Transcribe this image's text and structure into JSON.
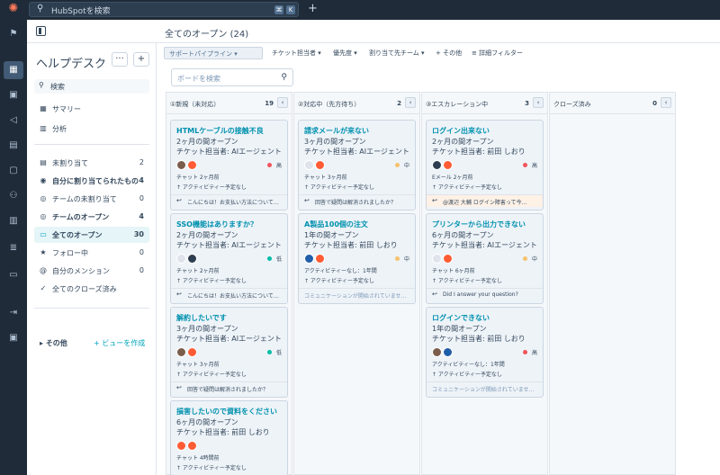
{
  "topbar": {
    "search_placeholder": "HubSpotを検索",
    "kbd1": "⌘",
    "kbd2": "K",
    "plus": "+"
  },
  "header": {
    "title": "全てのオープン (24)"
  },
  "sidebar": {
    "title": "ヘルプデスク",
    "more_btn": "···",
    "add_btn": "+",
    "search_label": "検索",
    "items": [
      {
        "icon": "▦",
        "label": "サマリー",
        "count": ""
      },
      {
        "icon": "▥",
        "label": "分析",
        "count": ""
      },
      {
        "icon": "▤",
        "label": "未割り当て",
        "count": "2"
      },
      {
        "icon": "◉",
        "label": "自分に割り当てられたもの",
        "count": "4"
      },
      {
        "icon": "◎",
        "label": "チームの未割り当て",
        "count": "0"
      },
      {
        "icon": "◎",
        "label": "チームのオープン",
        "count": "4"
      },
      {
        "icon": "▭",
        "label": "全てのオープン",
        "count": "30"
      },
      {
        "icon": "★",
        "label": "フォロー中",
        "count": "0"
      },
      {
        "icon": "@",
        "label": "自分のメンション",
        "count": "0"
      },
      {
        "icon": "✓",
        "label": "全てのクローズ済み",
        "count": ""
      }
    ],
    "other_label": "その他",
    "create_view": "+ ビューを作成"
  },
  "toolbar": {
    "pipeline": "サポートパイプライン",
    "owner": "チケット担当者",
    "priority": "優先度",
    "team": "割り当て先チーム",
    "other": "+ その他",
    "advanced": "詳細フィルター",
    "board_search_placeholder": "ボードを検索"
  },
  "columns": [
    {
      "name": "①新規（未対応）",
      "count": "19",
      "cards": [
        {
          "title": "HTMLケーブルの接触不良",
          "line1": "2ヶ月の間オープン",
          "line2": "チケット担当者: AIエージェント",
          "priority": "高",
          "priority_color": "#f2545b",
          "act1": "チャット 2ヶ月前",
          "act2": "↑ アクティビティー予定なし",
          "footer": "こんにちは！お支払い方法について…"
        },
        {
          "title": "SSO機能はありますか？",
          "line1": "2ヶ月の間オープン",
          "line2": "チケット担当者: AIエージェント",
          "priority": "低",
          "priority_color": "#00bda5",
          "act1": "チャット 2ヶ月前",
          "act2": "↑ アクティビティー予定なし",
          "footer": "こんにちは！お支払い方法について…"
        },
        {
          "title": "解約したいです",
          "line1": "3ヶ月の間オープン",
          "line2": "チケット担当者: AIエージェント",
          "priority": "低",
          "priority_color": "#00bda5",
          "act1": "チャット 3ヶ月前",
          "act2": "↑ アクティビティー予定なし",
          "footer": "回答で疑問は解消されましたか？"
        },
        {
          "title": "損害したいので資料をください",
          "line1": "6ヶ月の間オープン",
          "line2": "チケット担当者: 前田 しおり",
          "priority": "",
          "priority_color": "",
          "act1": "チャット 4時間前",
          "act2": "↑ アクティビティー予定なし",
          "footer": ""
        }
      ]
    },
    {
      "name": "②対応中（先方待ち）",
      "count": "2",
      "cards": [
        {
          "title": "請求メールが来ない",
          "line1": "3ヶ月の間オープン",
          "line2": "チケット担当者: AIエージェント",
          "priority": "中",
          "priority_color": "#f5c26b",
          "act1": "チャット 3ヶ月前",
          "act2": "↑ アクティビティー予定なし",
          "footer": "回答で疑問は解消されましたか？"
        },
        {
          "title": "A製品100個の注文",
          "line1": "1年の間オープン",
          "line2": "チケット担当者: 前田 しおり",
          "priority": "中",
          "priority_color": "#f5c26b",
          "act1": "アクティビティーなし：1年間",
          "act2": "↑ アクティビティー予定なし",
          "footer": "コミュニケーションが開始されていませ…"
        }
      ]
    },
    {
      "name": "③エスカレーション中",
      "count": "3",
      "cards": [
        {
          "title": "ログイン出来ない",
          "line1": "2ヶ月の間オープン",
          "line2": "チケット担当者: 前田 しおり",
          "priority": "高",
          "priority_color": "#f2545b",
          "act1": "Eメール 2ヶ月前",
          "act2": "↑ アクティビティー予定なし",
          "footer": "@渡辺 大輔 ログイン障害って今…"
        },
        {
          "title": "プリンターから出力できない",
          "line1": "6ヶ月の間オープン",
          "line2": "チケット担当者: AIエージェント",
          "priority": "中",
          "priority_color": "#f5c26b",
          "act1": "チャット 6ヶ月前",
          "act2": "↑ アクティビティー予定なし",
          "footer": "Did I answer your question?"
        },
        {
          "title": "ログインできない",
          "line1": "1年の間オープン",
          "line2": "チケット担当者: 前田 しおり",
          "priority": "高",
          "priority_color": "#f2545b",
          "act1": "アクティビティーなし：1年間",
          "act2": "↑ アクティビティー予定なし",
          "footer": "コミュニケーションが開始されていませ…"
        }
      ]
    },
    {
      "name": "クローズ済み",
      "count": "0",
      "cards": []
    }
  ],
  "rail_icons": [
    "bookmark-icon",
    "grid-icon",
    "contacts-icon",
    "megaphone-icon",
    "content-icon",
    "commerce-icon",
    "automation-icon",
    "reports-icon",
    "data-icon",
    "library-icon",
    "expand-icon",
    "panel-icon"
  ]
}
